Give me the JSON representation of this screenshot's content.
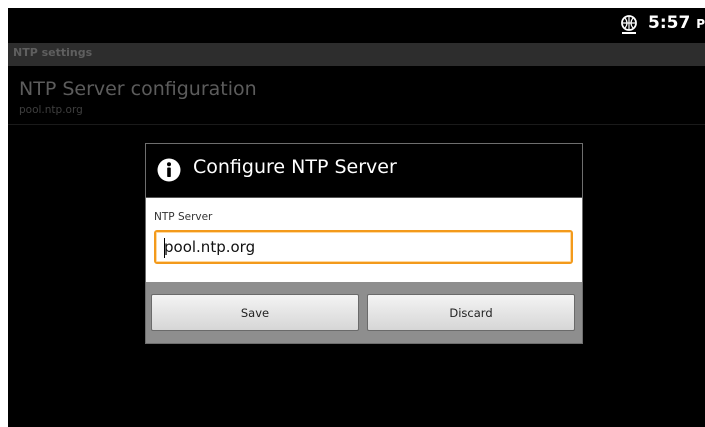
{
  "status_bar": {
    "time": "5:57",
    "ampm": "PM",
    "icon": "sync-globe-icon"
  },
  "activity": {
    "title": "NTP settings"
  },
  "preference": {
    "title": "NTP Server configuration",
    "summary": "pool.ntp.org"
  },
  "dialog": {
    "title": "Configure NTP Server",
    "icon": "info-icon",
    "field_label": "NTP Server",
    "field_value": "pool.ntp.org",
    "save_label": "Save",
    "discard_label": "Discard"
  },
  "colors": {
    "input_focus": "#f39a1b",
    "dialog_footer": "#8e8e8e",
    "title_bar": "#2d2d2d"
  }
}
